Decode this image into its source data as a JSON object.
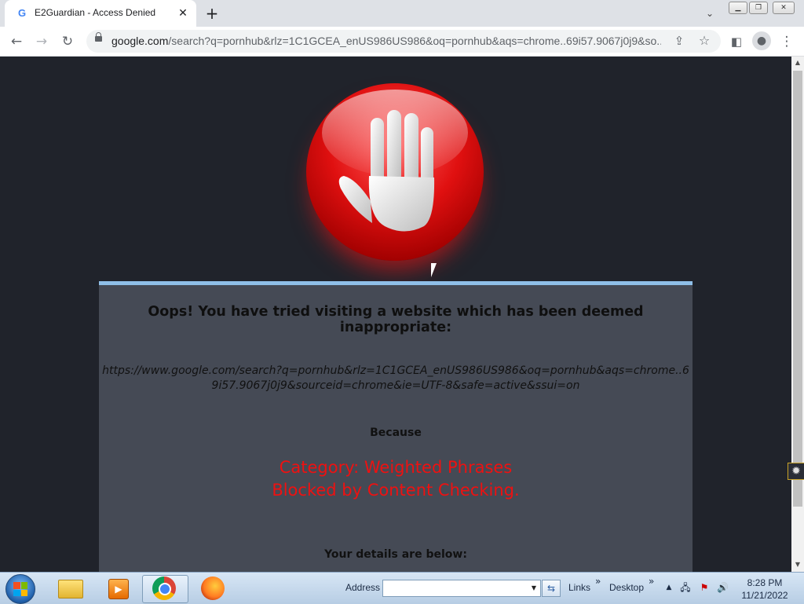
{
  "browser": {
    "tab_title": "E2Guardian - Access Denied",
    "tab_favicon": "G",
    "tab_close": "✕",
    "new_tab": "+",
    "address": {
      "host": "google.com",
      "rest": "/search?q=pornhub&rlz=1C1GCEA_enUS986US986&oq=pornhub&aqs=chrome..69i57.9067j0j9&so..."
    }
  },
  "page": {
    "headline": "Oops! You have tried visiting a website which has been deemed inappropriate:",
    "blocked_url": "https://www.google.com/search?q=pornhub&rlz=1C1GCEA_enUS986US986&oq=pornhub&aqs=chrome..69i57.9067j0j9&sourceid=chrome&ie=UTF-8&safe=active&ssui=on",
    "because_label": "Because",
    "reason_line1": "Category: Weighted Phrases",
    "reason_line2": "Blocked by Content Checking.",
    "details_label": "Your details are below:"
  },
  "taskbar": {
    "address_label": "Address",
    "address_value": "",
    "links_label": "Links",
    "desktop_label": "Desktop",
    "chevron": "»",
    "time": "8:28 PM",
    "date": "11/21/2022"
  },
  "colors": {
    "page_background": "#20232b",
    "panel_background": "#454a55",
    "panel_border": "#8fbfe8",
    "reason_text": "#ee1111"
  }
}
